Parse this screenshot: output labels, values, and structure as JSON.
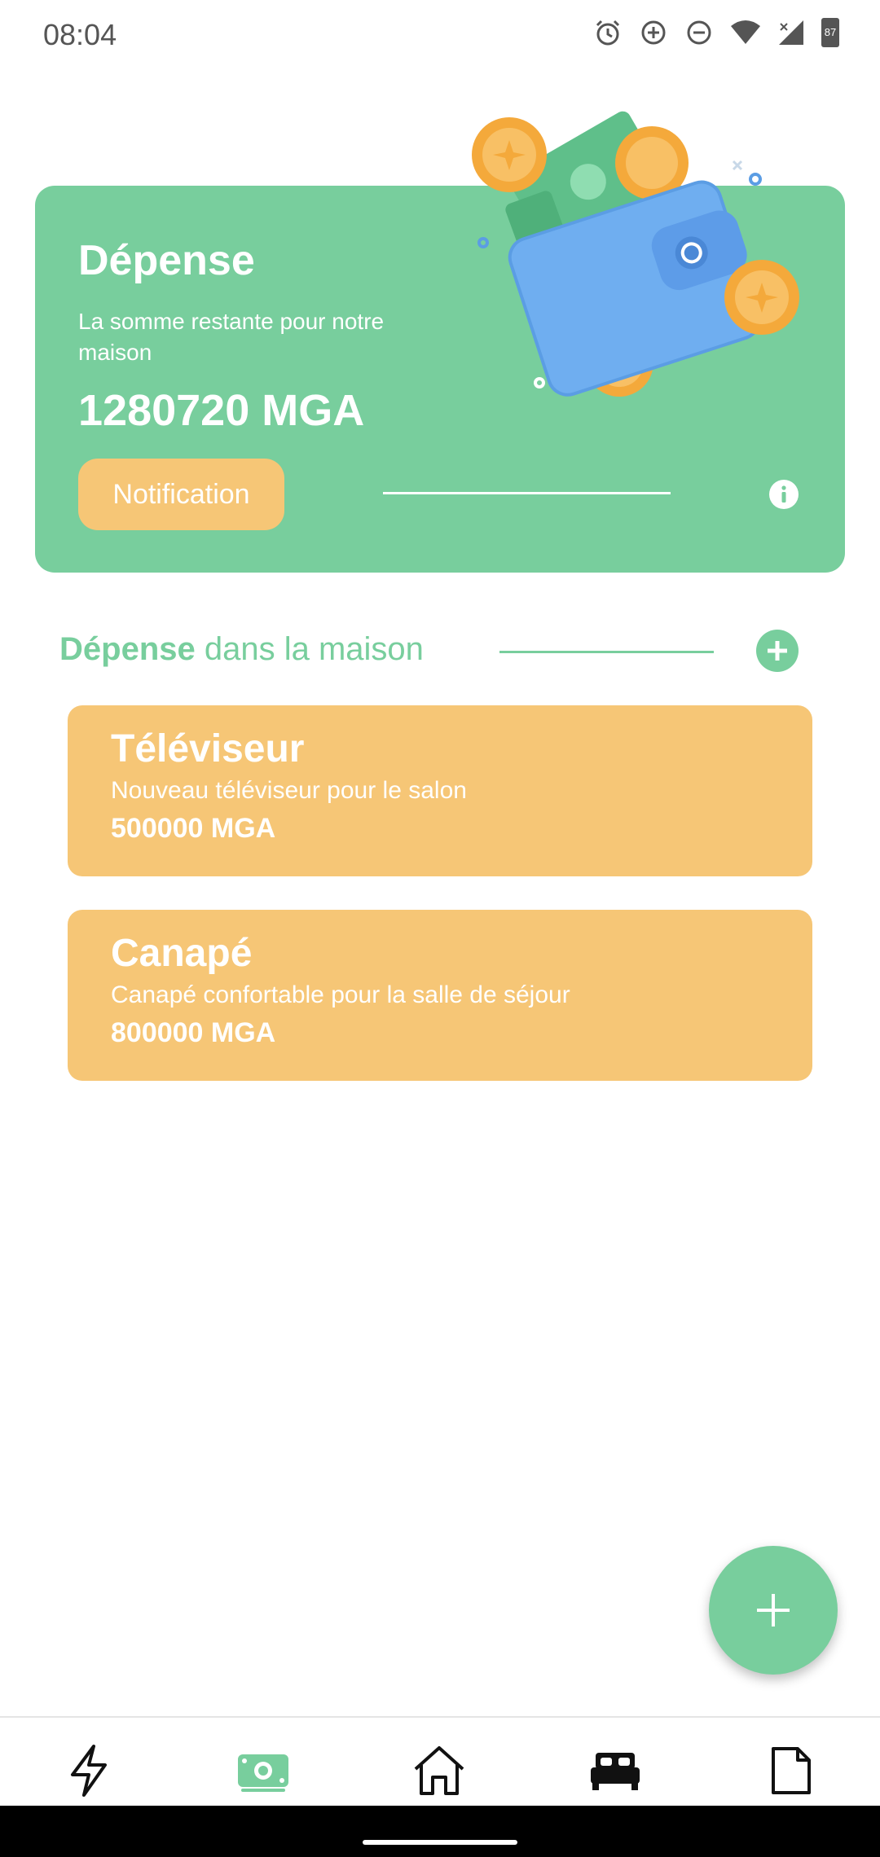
{
  "status_bar": {
    "time": "08:04",
    "battery": "87",
    "icons": [
      "alarm-icon",
      "data-saver-icon",
      "do-not-disturb-icon",
      "wifi-icon",
      "signal-icon",
      "battery-icon"
    ]
  },
  "hero": {
    "title": "Dépense",
    "subtitle": "La somme restante pour notre maison",
    "amount": "1280720 MGA",
    "notification_label": "Notification",
    "background_color": "#78CE9D",
    "accent_color": "#F6C676"
  },
  "section": {
    "title_bold": "Dépense",
    "title_rest": " dans la maison"
  },
  "expenses": [
    {
      "title": "Téléviseur",
      "description": "Nouveau téléviseur pour le salon",
      "amount": "500000 MGA"
    },
    {
      "title": "Canapé",
      "description": "Canapé confortable pour la salle de séjour",
      "amount": "800000 MGA"
    }
  ],
  "bottom_nav": {
    "items": [
      "lightning-icon",
      "money-icon",
      "home-icon",
      "bed-icon",
      "document-icon"
    ],
    "active": "money-icon",
    "active_color": "#78CE9D"
  }
}
